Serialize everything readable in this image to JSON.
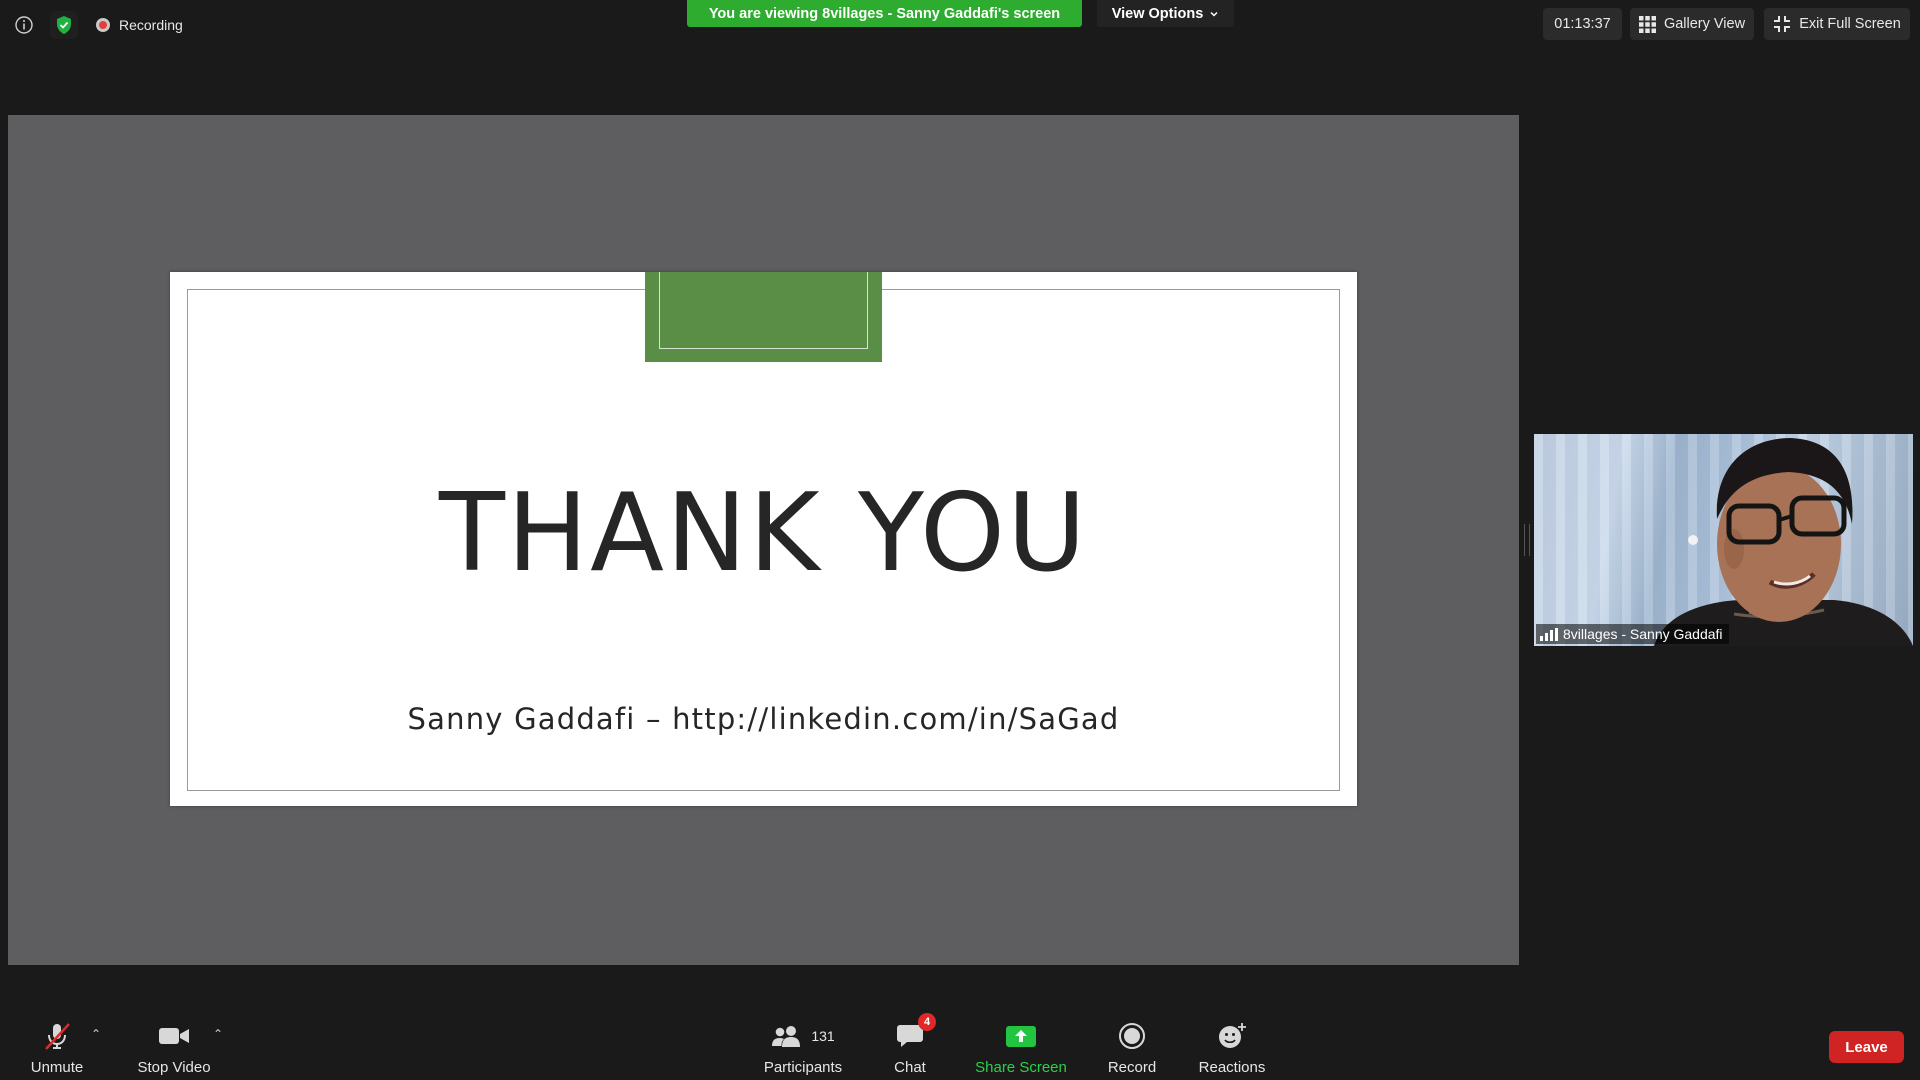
{
  "topbar": {
    "recording_label": "Recording",
    "viewing_banner": "You are viewing 8villages - Sanny Gaddafi's screen",
    "view_options_label": "View Options",
    "timer": "01:13:37",
    "gallery_view_label": "Gallery View",
    "exit_fullscreen_label": "Exit Full Screen",
    "accent_green": "#2dac2f"
  },
  "slide": {
    "title": "THANK YOU",
    "subtitle": "Sanny Gaddafi – http://linkedin.com/in/SaGad",
    "accent_color": "#5a8e47"
  },
  "video_tile": {
    "name": "8villages - Sanny Gaddafi"
  },
  "toolbar": {
    "unmute_label": "Unmute",
    "stop_video_label": "Stop Video",
    "participants_label": "Participants",
    "participants_count": "131",
    "chat_label": "Chat",
    "chat_badge": "4",
    "share_screen_label": "Share Screen",
    "record_label": "Record",
    "reactions_label": "Reactions",
    "leave_label": "Leave",
    "leave_color": "#d02323"
  }
}
